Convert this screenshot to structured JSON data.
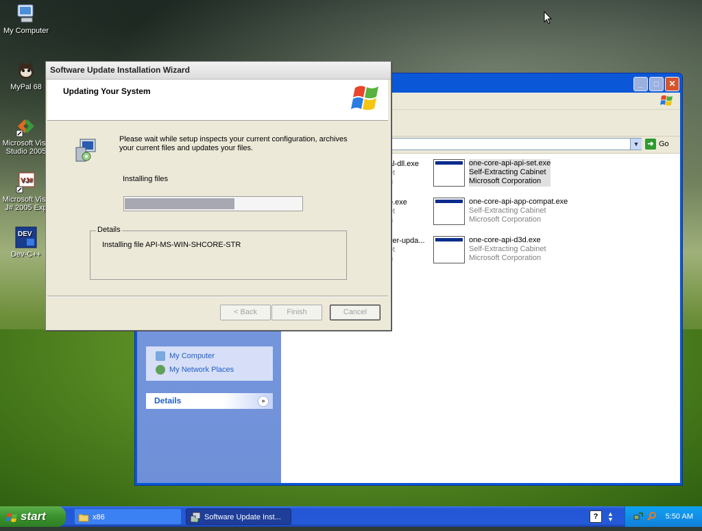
{
  "desktop": {
    "icons": [
      {
        "label": "My Computer"
      },
      {
        "label": "MyPal 68"
      },
      {
        "label": "Microsoft Visu Studio 2005"
      },
      {
        "label": "Microsoft Visu J# 2005 Exp"
      },
      {
        "label": "Dev-C++"
      }
    ]
  },
  "explorer": {
    "go_label": "Go",
    "side_tasks": [
      {
        "label": "My Computer"
      },
      {
        "label": "My Network Places"
      }
    ],
    "details_label": "Details",
    "files": [
      {
        "name": "one-core-api-api-set.exe",
        "type": "Self-Extracting Cabinet",
        "company": "Microsoft Corporation"
      },
      {
        "name": "one-core-api-app-compat.exe",
        "type": "Self-Extracting Cabinet",
        "company": "Microsoft Corporation"
      },
      {
        "name": "one-core-api-d3d.exe",
        "type": "Self-Extracting Cabinet",
        "company": "Microsoft Corporation"
      }
    ],
    "partial_files": [
      {
        "name": "al-dll.exe",
        "type": "et",
        "company": "n"
      },
      {
        "name": "e.exe",
        "type": "et",
        "company": "n"
      },
      {
        "name": "ver-upda...",
        "type": "et",
        "company": "n"
      }
    ]
  },
  "wizard": {
    "title": "Software Update Installation Wizard",
    "header": "Updating Your System",
    "message": "Please wait while setup inspects your current configuration, archives your current files and updates your files.",
    "status": "Installing files",
    "progress": 0.62,
    "details_legend": "Details",
    "details_line": "Installing file API-MS-WIN-SHCORE-STR",
    "buttons": {
      "back": "< Back",
      "finish": "Finish",
      "cancel": "Cancel"
    }
  },
  "taskbar": {
    "start_label": "start",
    "tasks": [
      {
        "label": "x86"
      },
      {
        "label": "Software Update Inst..."
      }
    ],
    "help_label": "?",
    "clock": "5:50 AM"
  }
}
